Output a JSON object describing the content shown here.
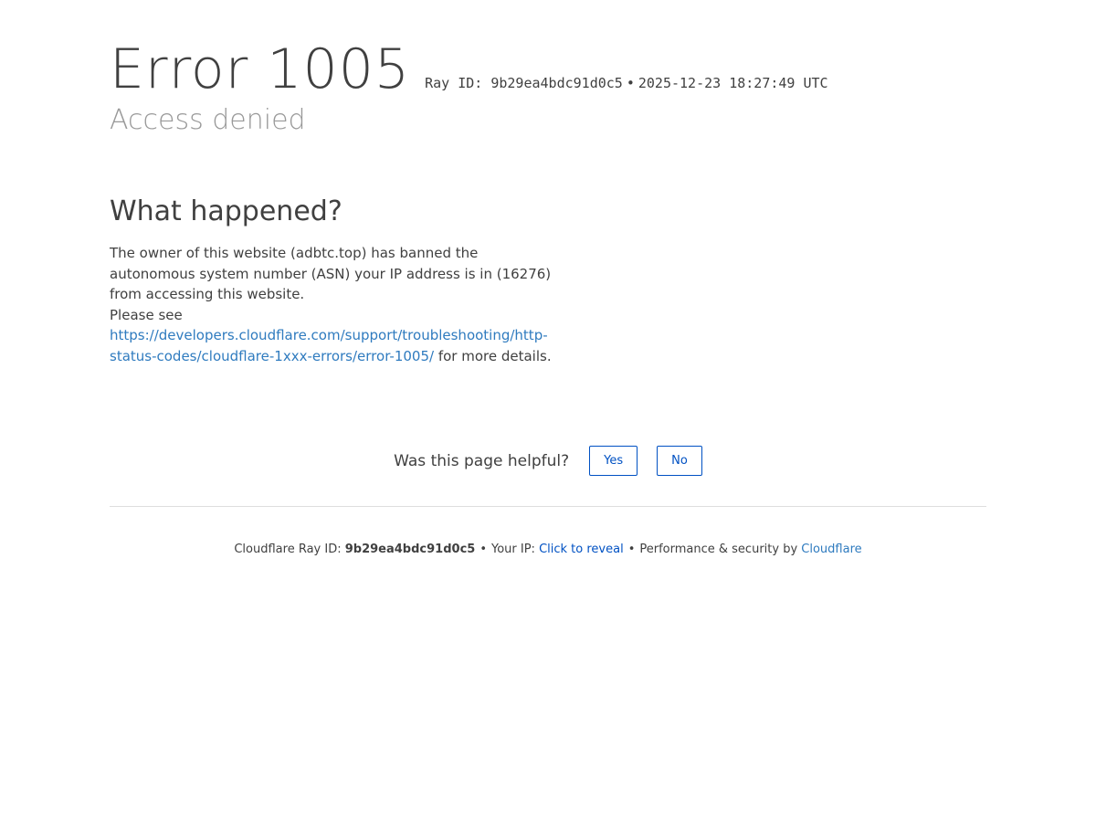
{
  "header": {
    "error_title": "Error 1005",
    "ray_label": "Ray ID: 9b29ea4bdc91d0c5",
    "dot": "•",
    "timestamp": "2025-12-23 18:27:49 UTC",
    "subtitle": "Access denied"
  },
  "what_happened": {
    "heading": "What happened?",
    "paragraph_1": "The owner of this website (adbtc.top) has banned the autonomous system number (ASN) your IP address is in (16276) from accessing this website.",
    "please_see": "Please see",
    "link_text": "https://developers.cloudflare.com/support/troubleshooting/http-status-codes/cloudflare-1xxx-errors/error-1005/",
    "after_link": " for more details."
  },
  "feedback": {
    "question": "Was this page helpful?",
    "yes_label": "Yes",
    "no_label": "No"
  },
  "footer": {
    "ray_label": "Cloudflare Ray ID: ",
    "ray_id": "9b29ea4bdc91d0c5",
    "separator": "•",
    "ip_label": "Your IP: ",
    "ip_reveal": "Click to reveal",
    "perf_label": "Performance & security by ",
    "cloudflare_link": "Cloudflare"
  },
  "colors": {
    "text": "#404040",
    "subtitle": "#999999",
    "link": "#2f7bbf",
    "button": "#0051c3",
    "divider": "#dedede"
  }
}
